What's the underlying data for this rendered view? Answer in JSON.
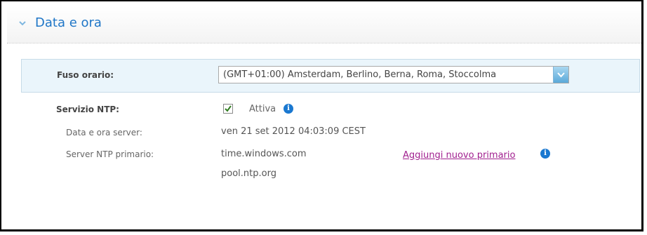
{
  "section": {
    "title": "Data e ora"
  },
  "timezone": {
    "label": "Fuso orario:",
    "selected": "(GMT+01:00) Amsterdam, Berlino, Berna, Roma, Stoccolma"
  },
  "ntp": {
    "label": "Servizio NTP:",
    "checkbox_label": "Attiva",
    "checked": true,
    "server_datetime_label": "Data e ora server:",
    "server_datetime_value": "ven 21 set 2012 04:03:09 CEST",
    "primary_label": "Server NTP primario:",
    "primary_value": "time.windows.com",
    "add_link": "Aggiungi nuovo primario",
    "secondary_value": "pool.ntp.org"
  },
  "colors": {
    "accent": "#1f76c7",
    "link": "#a1208f",
    "row_bg": "#eaf5fb"
  }
}
